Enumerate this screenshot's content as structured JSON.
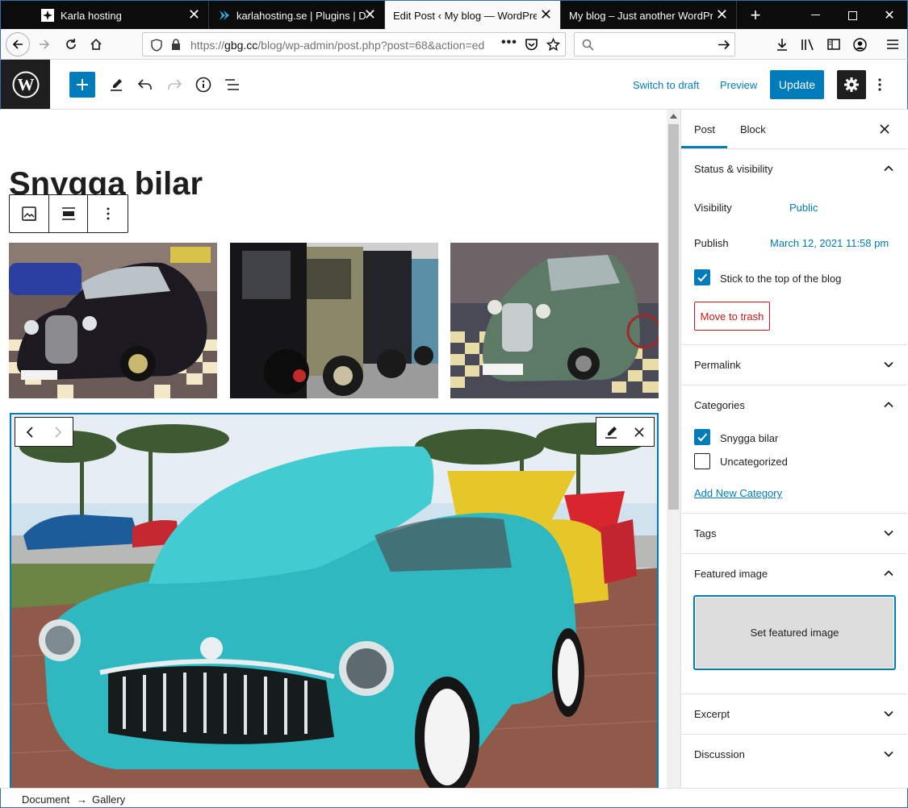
{
  "browser": {
    "tabs": [
      {
        "title": "Karla hosting",
        "active": false
      },
      {
        "title": "karlahosting.se | Plugins | Dire",
        "active": false
      },
      {
        "title": "Edit Post ‹ My blog — WordPress",
        "active": true
      },
      {
        "title": "My blog – Just another WordPress",
        "active": false
      }
    ],
    "url_prefix": "https://",
    "url_host": "gbg.cc",
    "url_path": "/blog/wp-admin/post.php?post=68&action=ed"
  },
  "toolbar": {
    "switch_to_draft": "Switch to draft",
    "preview": "Preview",
    "update": "Update"
  },
  "post": {
    "title": "Snygga bilar"
  },
  "sidebar": {
    "tab_post": "Post",
    "tab_block": "Block",
    "status_visibility": "Status & visibility",
    "visibility_label": "Visibility",
    "visibility_value": "Public",
    "publish_label": "Publish",
    "publish_value": "March 12, 2021 11:58 pm",
    "sticky_label": "Stick to the top of the blog",
    "sticky_checked": true,
    "move_to_trash": "Move to trash",
    "permalink": "Permalink",
    "categories": "Categories",
    "category_items": [
      {
        "label": "Snygga bilar",
        "checked": true
      },
      {
        "label": "Uncategorized",
        "checked": false
      }
    ],
    "add_new_category": "Add New Category",
    "tags": "Tags",
    "featured_image": "Featured image",
    "set_featured_image": "Set featured image",
    "excerpt": "Excerpt",
    "discussion": "Discussion"
  },
  "breadcrumb": {
    "document": "Document",
    "arrow": "→",
    "gallery": "Gallery"
  },
  "colors": {
    "accent": "#007cba",
    "danger": "#cc1818",
    "dark": "#1e1e1e"
  }
}
